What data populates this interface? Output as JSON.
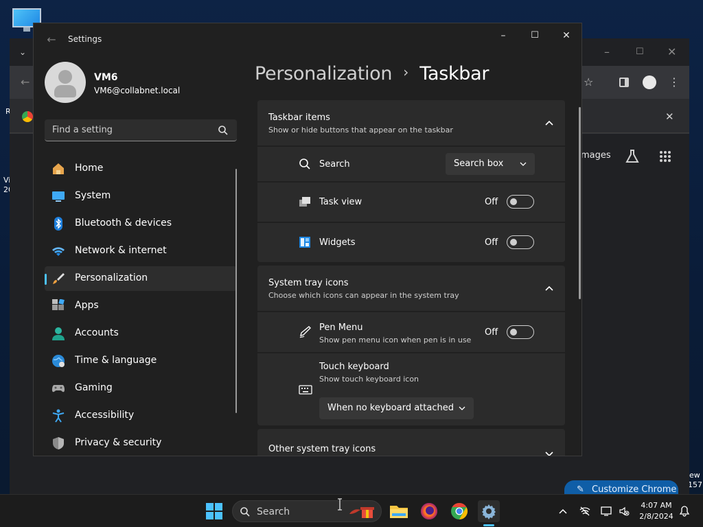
{
  "settings": {
    "window_title": "Settings",
    "user": {
      "name": "VM6",
      "email": "VM6@collabnet.local"
    },
    "search": {
      "placeholder": "Find a setting"
    },
    "nav": [
      {
        "label": "Home",
        "icon": "home-icon"
      },
      {
        "label": "System",
        "icon": "system-icon"
      },
      {
        "label": "Bluetooth & devices",
        "icon": "bluetooth-icon"
      },
      {
        "label": "Network & internet",
        "icon": "wifi-icon"
      },
      {
        "label": "Personalization",
        "icon": "brush-icon",
        "selected": true
      },
      {
        "label": "Apps",
        "icon": "apps-icon"
      },
      {
        "label": "Accounts",
        "icon": "accounts-icon"
      },
      {
        "label": "Time & language",
        "icon": "globe-clock-icon"
      },
      {
        "label": "Gaming",
        "icon": "gamepad-icon"
      },
      {
        "label": "Accessibility",
        "icon": "accessibility-icon"
      },
      {
        "label": "Privacy & security",
        "icon": "shield-icon"
      }
    ],
    "breadcrumb": {
      "parent": "Personalization",
      "separator": "›",
      "current": "Taskbar"
    },
    "taskbar_items": {
      "title": "Taskbar items",
      "subtitle": "Show or hide buttons that appear on the taskbar",
      "search": {
        "label": "Search",
        "value": "Search box"
      },
      "task_view": {
        "label": "Task view",
        "state": "Off"
      },
      "widgets": {
        "label": "Widgets",
        "state": "Off"
      }
    },
    "system_tray_icons": {
      "title": "System tray icons",
      "subtitle": "Choose which icons can appear in the system tray",
      "pen_menu": {
        "label": "Pen Menu",
        "subtitle": "Show pen menu icon when pen is in use",
        "state": "Off"
      },
      "touch_keyboard": {
        "label": "Touch keyboard",
        "subtitle": "Show touch keyboard icon",
        "value": "When no keyboard attached"
      }
    },
    "other_system_tray_icons": {
      "title": "Other system tray icons"
    }
  },
  "chrome": {
    "customize_label": "Customize Chrome",
    "images_label": "mages"
  },
  "desktop_fragments": {
    "r": "R",
    "vi": "Vi",
    "n20": "20",
    "ew": "ew",
    "n157": "157"
  },
  "taskbar": {
    "search_label": "Search",
    "time": "4:07 AM",
    "date": "2/8/2024"
  },
  "colors": {
    "accent": "#4cc2ff",
    "window_bg": "#202020",
    "card_bg": "#2b2b2b",
    "taskbar_bg": "#1c1c1c"
  }
}
